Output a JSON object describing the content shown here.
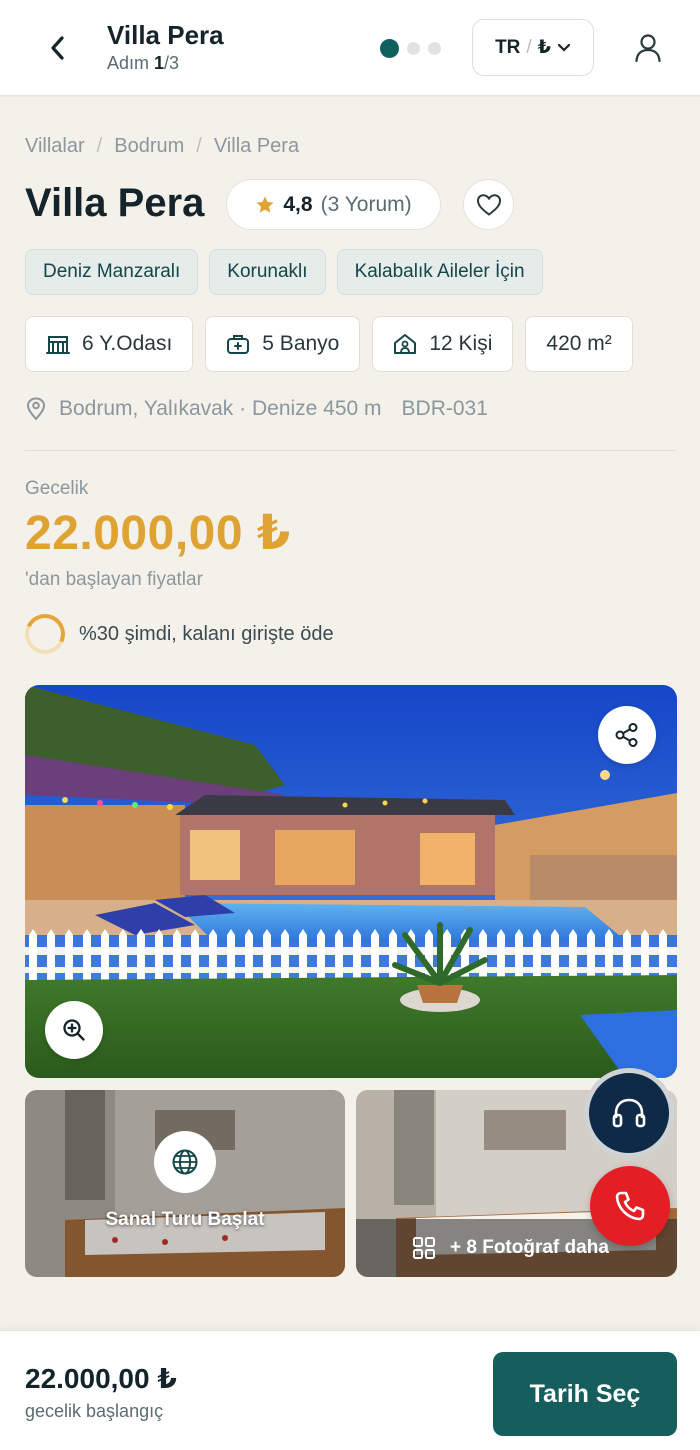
{
  "header": {
    "title": "Villa Pera",
    "step_label": "Adım",
    "step_current": "1",
    "step_total": "/3",
    "lang": "TR",
    "lang_sep": "/",
    "currency": "₺"
  },
  "breadcrumb": [
    "Villalar",
    "Bodrum",
    "Villa Pera"
  ],
  "villa": {
    "name": "Villa Pera",
    "rating": "4,8",
    "reviews": "(3 Yorum)"
  },
  "tags": [
    "Deniz Manzaralı",
    "Korunaklı",
    "Kalabalık Aileler İçin"
  ],
  "features": {
    "bedrooms": "6 Y.Odası",
    "bathrooms": "5 Banyo",
    "guests": "12 Kişi",
    "area": "420 m²"
  },
  "location": {
    "text": "Bodrum, Yalıkavak · Denize 450 m",
    "code": "BDR-031"
  },
  "price": {
    "label": "Gecelik",
    "amount": "22.000,00 ₺",
    "sub": "'dan başlayan fiyatlar",
    "deposit": "%30 şimdi, kalanı girişte öde"
  },
  "gallery": {
    "tour_label": "Sanal Turu Başlat",
    "more_label": "+ 8 Fotoğraf daha"
  },
  "bottom_bar": {
    "price": "22.000,00 ₺",
    "sub": "gecelik başlangıç",
    "button": "Tarih Seç"
  },
  "colors": {
    "accent": "#165d5d",
    "price": "#dfa334",
    "call": "#e31e24",
    "support": "#0e2a47"
  }
}
